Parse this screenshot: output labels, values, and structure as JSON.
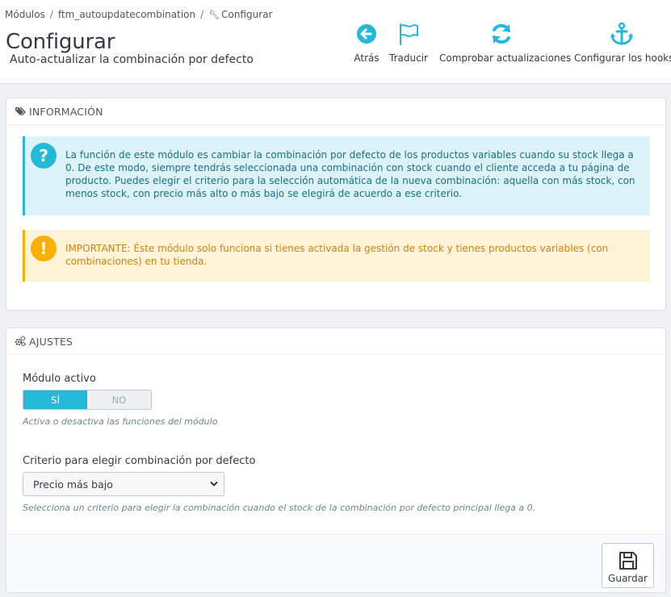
{
  "breadcrumb": {
    "items": [
      "Módulos",
      "ftm_autoupdatecombination",
      "Configurar"
    ],
    "separator": "/"
  },
  "header": {
    "title": "Configurar",
    "subtitle": "Auto-actualizar la combinación por defecto"
  },
  "toolbar": {
    "back": "Atrás",
    "translate": "Traducir",
    "check_updates": "Comprobar actualizaciones",
    "configure_hooks": "Configurar los hooks"
  },
  "info_panel": {
    "heading": "INFORMACIÓN",
    "info_text": "La función de este módulo es cambiar la combinación por defecto de los productos variables cuando su stock llega a 0. De este modo, siempre tendrás seleccionada una combinación con stock cuando el cliente acceda a tu página de producto. Puedes elegir el criterio para la selección automática de la nueva combinación: aquella con más stock, con menos stock, con precio más alto o más bajo se elegirá de acuerdo a ese criterio.",
    "warning_text": "IMPORTANTE: Éste módulo solo funciona si tienes activada la gestión de stock y tienes productos variables (con combinaciones) en tu tienda."
  },
  "settings_panel": {
    "heading": "AJUSTES",
    "active_label": "Módulo activo",
    "switch_yes": "SÍ",
    "switch_no": "NO",
    "switch_value": "SÍ",
    "active_help": "Activa o desactiva las funciones del módulo",
    "criteria_label": "Criterio para elegir combinación por defecto",
    "criteria_selected": "Precio más bajo",
    "criteria_help": "Selecciona un criterio para elegir la combinación cuando el stock de la combinación por defecto principal llega a 0.",
    "save_label": "Guardar"
  },
  "colors": {
    "accent": "#25b9d7",
    "warning": "#fab000",
    "page_bg": "#eff1f2"
  }
}
